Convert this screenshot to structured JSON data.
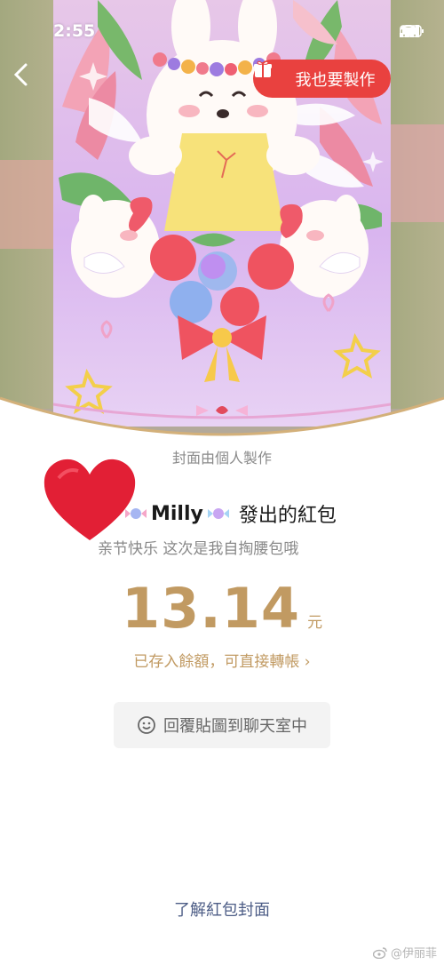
{
  "status_bar": {
    "time": "2:55"
  },
  "header": {
    "make_button_label": "我也要製作"
  },
  "cover": {
    "caption": "封面由個人製作"
  },
  "envelope": {
    "sender_name": "Milly",
    "sender_suffix": "發出的紅包",
    "greeting": "亲节快乐 这次是我自掏腰包哦",
    "amount": "13.14",
    "currency_unit": "元",
    "deposit_note": "已存入餘額，可直接轉帳 ›"
  },
  "actions": {
    "reply_sticker_label": "回覆貼圖到聊天室中",
    "learn_cover_label": "了解紅包封面"
  },
  "watermark": {
    "text": "@伊丽菲"
  },
  "colors": {
    "accent_red": "#e9413f",
    "amount_gold": "#c19a62",
    "link_blue": "#4d5d86"
  }
}
